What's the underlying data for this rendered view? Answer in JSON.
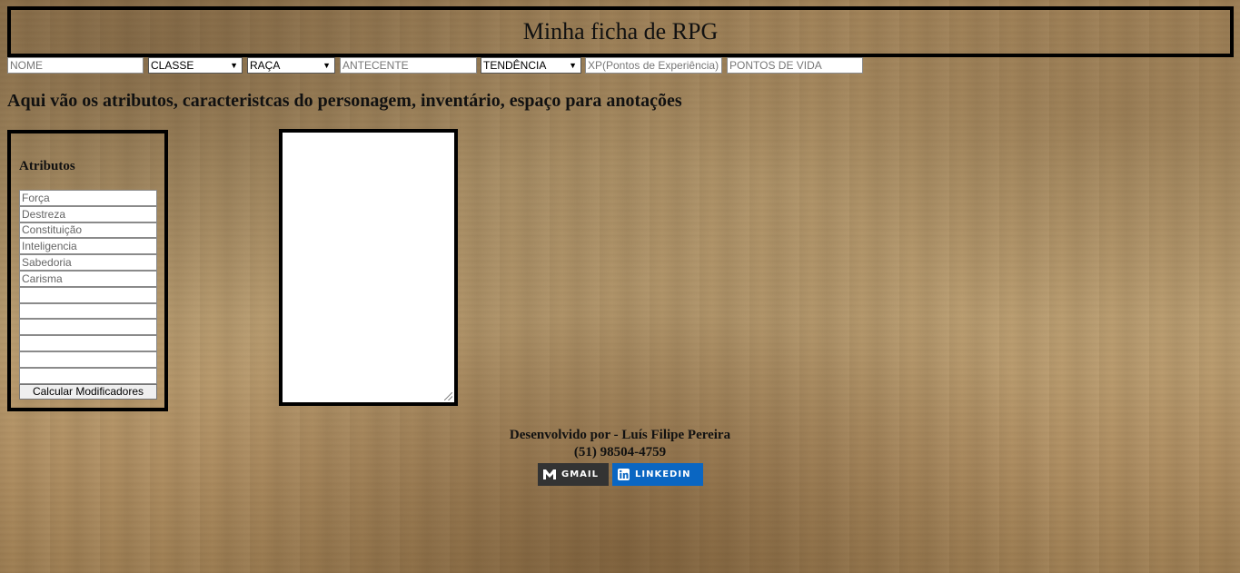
{
  "header": {
    "title": "Minha ficha de RPG"
  },
  "top_fields": {
    "name_placeholder": "NOME",
    "class_value": "CLASSE",
    "race_value": "RAÇA",
    "background_placeholder": "ANTECENTE",
    "alignment_value": "TENDÊNCIA",
    "xp_placeholder": "XP(Pontos de Experiência)",
    "hp_placeholder": "PONTOS DE VIDA"
  },
  "subtitle": "Aqui vão os atributos, caracteristcas do personagem, inventário, espaço para anotações",
  "attributes": {
    "heading": "Atributos",
    "fields": [
      {
        "placeholder": "Força"
      },
      {
        "placeholder": "Destreza"
      },
      {
        "placeholder": "Constituição"
      },
      {
        "placeholder": "Inteligencia"
      },
      {
        "placeholder": "Sabedoria"
      },
      {
        "placeholder": "Carisma"
      },
      {
        "placeholder": ""
      },
      {
        "placeholder": ""
      },
      {
        "placeholder": ""
      },
      {
        "placeholder": ""
      },
      {
        "placeholder": ""
      },
      {
        "placeholder": ""
      }
    ],
    "button_label": "Calcular Modificadores"
  },
  "notes": {
    "value": ""
  },
  "footer": {
    "developer": "Desenvolvido por - Luís Filipe Pereira",
    "phone": "(51) 98504-4759",
    "gmail_label": "GMAIL",
    "linkedin_label": "LINKEDIN"
  },
  "colors": {
    "gmail_badge": "#333333",
    "linkedin_badge": "#0a66c2",
    "border": "#000000"
  }
}
